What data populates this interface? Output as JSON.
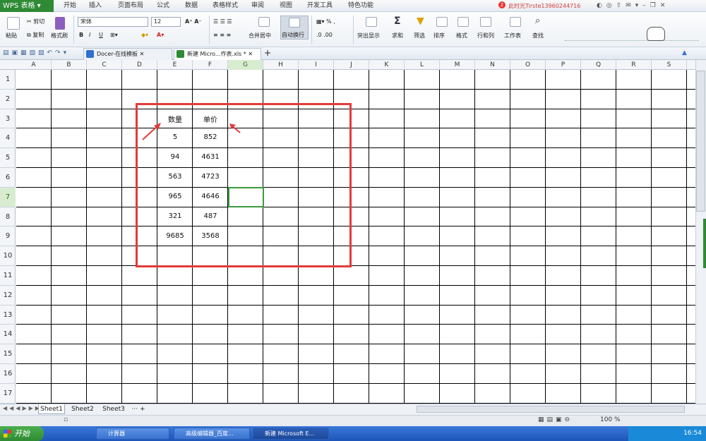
{
  "app": {
    "title": "WPS 表格",
    "user": "此时光Tirste13960244716"
  },
  "menu": {
    "tabs": [
      "开始",
      "插入",
      "页面布局",
      "公式",
      "数据",
      "表格样式",
      "审阅",
      "视图",
      "开发工具",
      "特色功能"
    ]
  },
  "ribbon": {
    "paste": "粘贴",
    "cut": "剪切",
    "copy": "复制",
    "format_painter": "格式刷",
    "font_name": "宋体",
    "font_size": "12",
    "bold": "B",
    "italic": "I",
    "underline": "U",
    "merge_center": "合并居中",
    "wrap_text": "自动换行",
    "percent": "%",
    "conditional": "突出显示",
    "sum": "求和",
    "filter": "筛选",
    "sort": "排序",
    "format": "格式",
    "row_col": "行和列",
    "worksheet": "工作表",
    "find": "查找"
  },
  "doc_tabs": [
    {
      "label": "Docer-在线模板"
    },
    {
      "label": "新建 Micro...作表.xls *"
    }
  ],
  "columns": [
    "A",
    "B",
    "C",
    "D",
    "E",
    "F",
    "G",
    "H",
    "I",
    "J",
    "K",
    "L",
    "M",
    "N",
    "O",
    "P",
    "Q",
    "R",
    "S"
  ],
  "rows": [
    "1",
    "2",
    "3",
    "4",
    "5",
    "6",
    "7",
    "8",
    "9",
    "10",
    "11",
    "12",
    "13",
    "14",
    "15",
    "16",
    "17"
  ],
  "cells": {
    "e3": "数量",
    "f3": "单价",
    "e4": "5",
    "f4": "852",
    "e5": "94",
    "f5": "4631",
    "e6": "563",
    "f6": "4723",
    "e7": "965",
    "f7": "4646",
    "e8": "321",
    "f8": "487",
    "e9": "9685",
    "f9": "3568"
  },
  "sheets": [
    "Sheet1",
    "Sheet2",
    "Sheet3"
  ],
  "status": {
    "zoom": "100 %"
  },
  "taskbar": {
    "start": "开始",
    "tasks": [
      "计算器",
      "高级编辑器_百度...",
      "新建 Microsoft E..."
    ],
    "time": "16:54"
  },
  "colors": {
    "accent": "#2f8a35",
    "annotation": "#e23b3b",
    "selected_cell": "#3c9a3c"
  }
}
